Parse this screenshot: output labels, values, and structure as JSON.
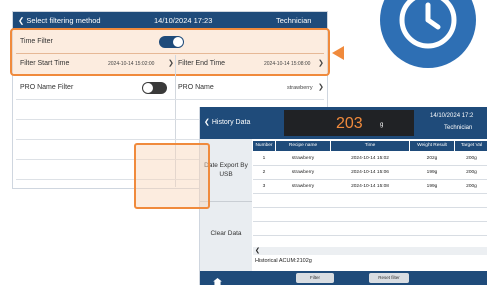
{
  "filter_screen": {
    "back_label": "Select filtering method",
    "datetime": "14/10/2024 17:23",
    "role": "Technician",
    "time_filter_label": "Time Filter",
    "time_filter_on": true,
    "filter_start_label": "Filter Start Time",
    "filter_start_value": "2024-10-14 15:02:00",
    "filter_end_label": "Filter End Time",
    "filter_end_value": "2024-10-14 15:08:00",
    "pro_name_filter_label": "PRO Name Filter",
    "pro_name_filter_on": false,
    "pro_name_label": "PRO Name",
    "pro_name_value": "strawberry"
  },
  "history_screen": {
    "back_label": "History Data",
    "big_value": "203",
    "big_unit": "g",
    "datetime": "14/10/2024 17:2",
    "role": "Technician",
    "date_export_label": "Date Export By USB",
    "clear_data_label": "Clear Data",
    "columns": [
      "Number",
      "Recipe name",
      "Time",
      "Weight Result",
      "Target Val"
    ],
    "rows": [
      [
        "1",
        "strawberry",
        "2024-10-14 15:02",
        "202g",
        "200g"
      ],
      [
        "2",
        "strawberry",
        "2024-10-14 15:06",
        "199g",
        "200g"
      ],
      [
        "3",
        "strawberry",
        "2024-10-14 15:08",
        "199g",
        "200g"
      ]
    ],
    "historical_label": "Historical  ACUM:2102g",
    "home_label": "Home",
    "filter_button": "Filter",
    "reset_filter_button": "Reset filter"
  },
  "colors": {
    "header": "#1f4b7a",
    "highlight": "#f08a3c",
    "clock": "#2e6fb4"
  },
  "icons": [
    "clock-icon",
    "chevron-left-icon",
    "chevron-right-icon",
    "home-icon",
    "arrow-left-icon"
  ]
}
